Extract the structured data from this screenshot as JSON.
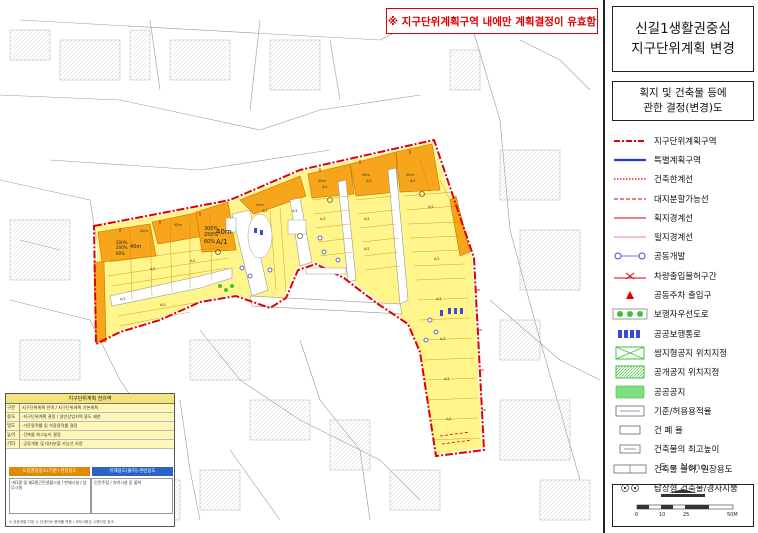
{
  "notice": "※ 지구단위계획구역 내에만 계획결정이 유효함",
  "title": {
    "line1": "신길1생활권중심",
    "line2": "지구단위계획 변경"
  },
  "subtitle": {
    "line1": "획지 및 건축물 등에",
    "line2": "관한 결정(변경)도"
  },
  "legend": [
    {
      "key": "district-boundary",
      "label": "지구단위계획구역",
      "color": "#e00000"
    },
    {
      "key": "special-plan-zone",
      "label": "특별계획구역",
      "color": "#1f3fbf"
    },
    {
      "key": "building-line",
      "label": "건축한계선",
      "color": "#e00000"
    },
    {
      "key": "lot-split-line",
      "label": "대지분할가능선",
      "color": "#e00000"
    },
    {
      "key": "lot-boundary",
      "label": "획지경계선",
      "color": "#e00000"
    },
    {
      "key": "parcel-boundary",
      "label": "필지경계선",
      "color": "#e00000"
    },
    {
      "key": "joint-development",
      "label": "공동개발",
      "color": "#3b4bd0"
    },
    {
      "key": "vehicle-access-ban",
      "label": "차량출입불허구간",
      "color": "#e00000"
    },
    {
      "key": "shared-parking-entrance",
      "label": "공동주차 출입구",
      "color": "#e00000"
    },
    {
      "key": "pedestrian-priority-road",
      "label": "보행자우선도로",
      "color": "#3cc23c"
    },
    {
      "key": "public-walkway",
      "label": "공공보행통로",
      "color": "#3b4bd0"
    },
    {
      "key": "pocket-open-space",
      "label": "쌈지형공지 위치지정",
      "color": "#3cc23c"
    },
    {
      "key": "public-open-space-site",
      "label": "공개공지 위치지정",
      "color": "#3cc23c"
    },
    {
      "key": "public-open-space",
      "label": "공공공지",
      "color": "#7ee07e"
    },
    {
      "key": "far-ratio",
      "label": "기준/허용용적율",
      "color": "#333333"
    },
    {
      "key": "coverage-ratio",
      "label": "건 폐 율",
      "color": "#333333"
    },
    {
      "key": "max-height",
      "label": "건축물의 최고높이",
      "color": "#333333"
    },
    {
      "key": "use-restriction",
      "label": "건축물 불허, 권장용도",
      "color": "#333333"
    },
    {
      "key": "tower-building",
      "label": "탑상형 건축물/경사지붕",
      "color": "#333333"
    }
  ],
  "scale_note": "S = None",
  "scale_bar": {
    "labels": [
      "0",
      "10",
      "25",
      "50M"
    ]
  },
  "map": {
    "lot_labels": [
      "300%",
      "250%",
      "40m",
      "60%",
      "A/1",
      "200%",
      "200%",
      "60%",
      "40m"
    ]
  },
  "plan_table": {
    "header": "지구단위계획 전의역",
    "rows": [
      {
        "label": "구분",
        "text": "지구단위계획 전역 / 지구단위계획 기본계획"
      },
      {
        "label": "용도",
        "text": "·지구단위계획 결정 / 일반상업지역 용도 제한"
      },
      {
        "label": "밀도",
        "text": "·기준용적률 및 허용용적률 결정"
      },
      {
        "label": "높이",
        "text": "·건축물 최고높이 결정"
      },
      {
        "label": "기타",
        "text": "·공동개발 및 대지분할 가능선 지정"
      }
    ],
    "sub_left": "도입권장용도(기준)·권장용도",
    "sub_right": "유해용도(불허)·관련용도",
    "lower_left": "·제1종 및 제2종근린생활시설 / 판매시설 / 업무시설",
    "lower_right": "·단란주점 / 숙박시설 등 불허",
    "footnote": "※ 공동개발 지정 시 인센티브 용적률 적용 / 세부사항은 시행지침 참조"
  }
}
